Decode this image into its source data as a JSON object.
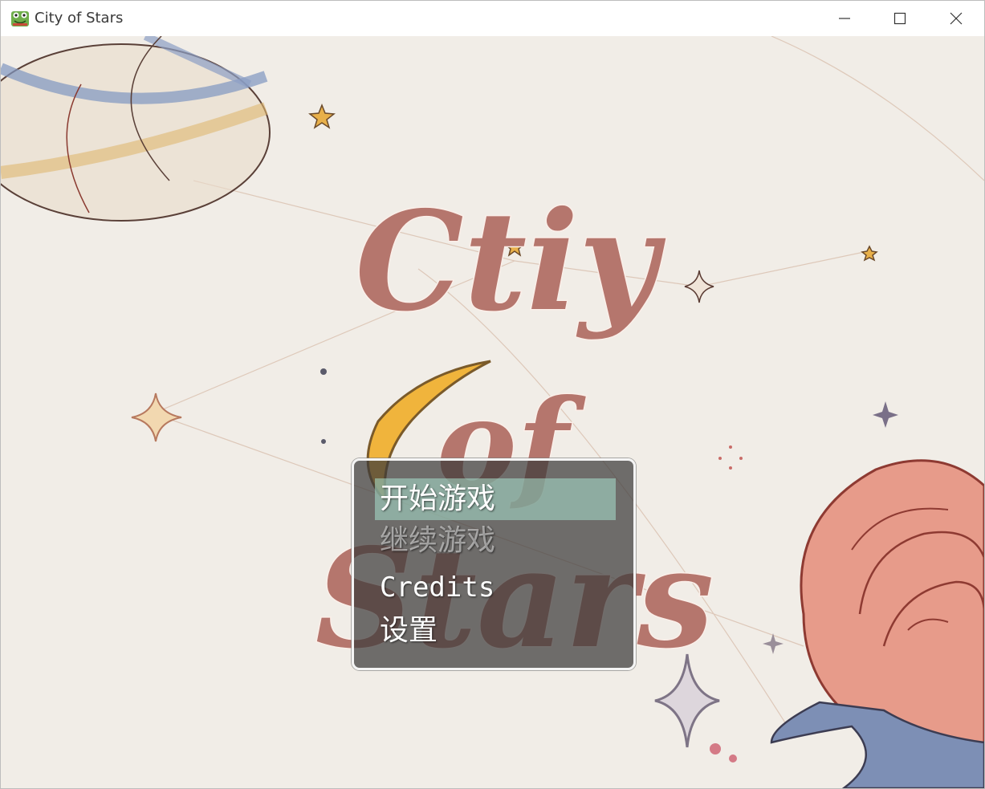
{
  "window": {
    "title": "City of Stars",
    "icon": "frog-app-icon",
    "controls": [
      "minimize-icon",
      "maximize-icon",
      "close-icon"
    ]
  },
  "title_art": {
    "line1": "Ctiy",
    "line2": "of",
    "line3": "Stars",
    "color": "#b5766d"
  },
  "menu": {
    "items": [
      {
        "label": "开始游戏",
        "state": "selected"
      },
      {
        "label": "继续游戏",
        "state": "disabled"
      },
      {
        "label": "Credits",
        "state": "normal"
      },
      {
        "label": "设置",
        "state": "normal"
      }
    ],
    "highlight_color": "#aae1cd"
  },
  "colors": {
    "paper": "#f1ede7",
    "star_gold": "#e8b04a",
    "rose": "#d98a7c",
    "moon": "#f0b43c"
  }
}
